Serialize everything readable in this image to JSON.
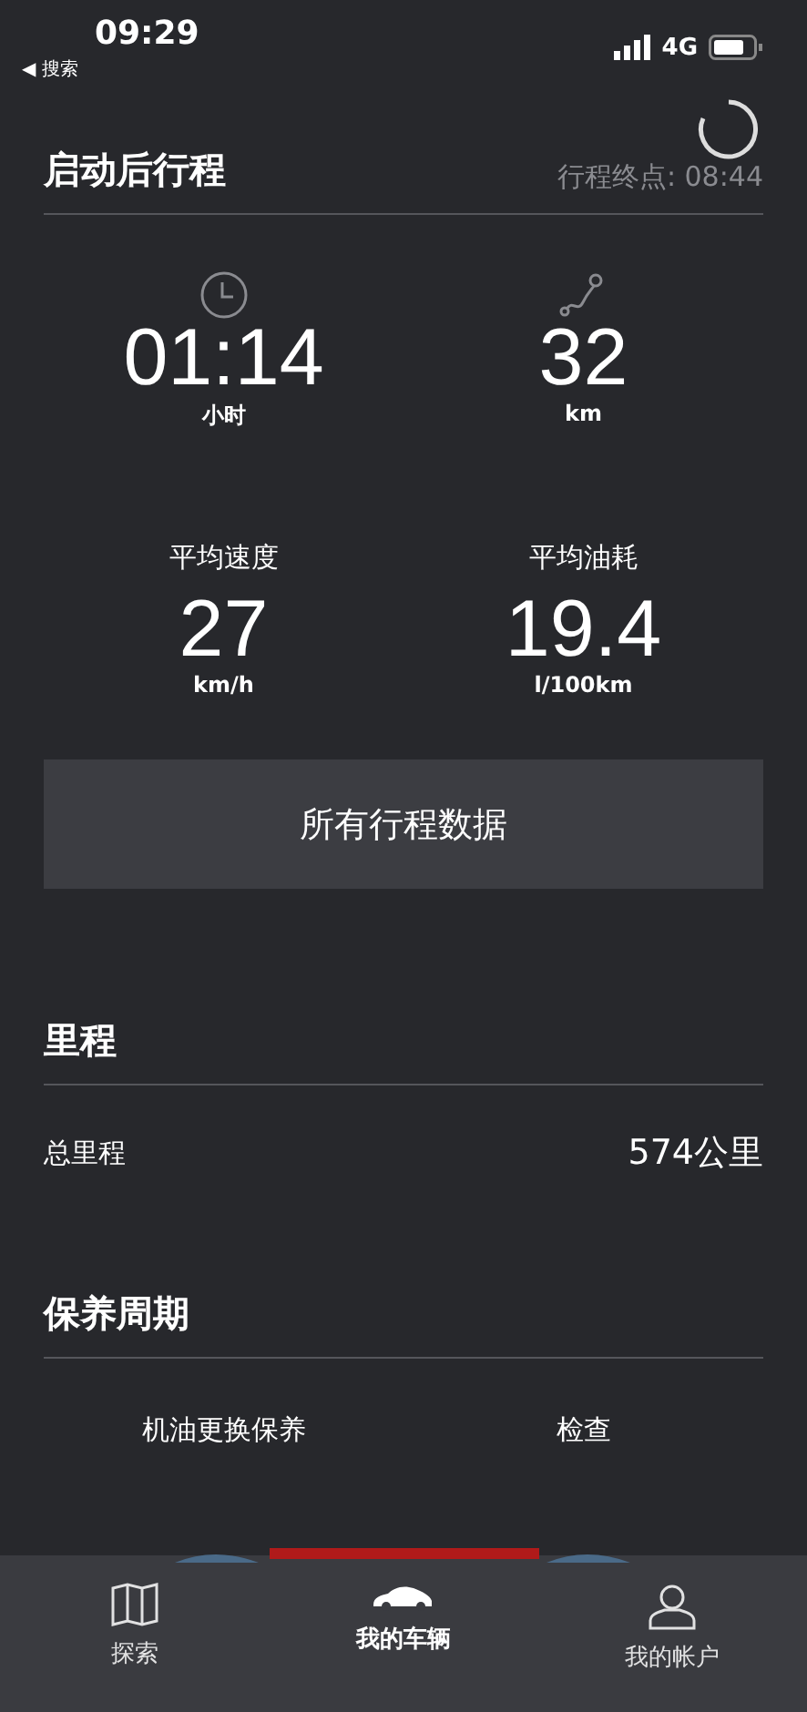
{
  "status_bar": {
    "time": "09:29",
    "back": "◀ 搜索",
    "network": "4G"
  },
  "trip": {
    "title": "启动后行程",
    "end_time": "行程终点: 08:44",
    "stats": [
      {
        "kind": "clock",
        "value": "01:14",
        "unit": "小时"
      },
      {
        "kind": "route",
        "value": "32",
        "unit": "km"
      },
      {
        "kind": "plain",
        "label": "平均速度",
        "value": "27",
        "unit": "km/h"
      },
      {
        "kind": "plain",
        "label": "平均油耗",
        "value": "19.4",
        "unit": "l/100km"
      }
    ],
    "button": "所有行程数据"
  },
  "mileage": {
    "title": "里程",
    "rows": [
      {
        "label": "总里程",
        "value": "574公里"
      }
    ]
  },
  "maintenance": {
    "title": "保养周期",
    "items": [
      {
        "label": "机油更换保养"
      },
      {
        "label": "检查"
      }
    ]
  },
  "tabs": [
    {
      "label": "探索",
      "kind": "map",
      "selected": false
    },
    {
      "label": "我的车辆",
      "kind": "car",
      "selected": true
    },
    {
      "label": "我的帐户",
      "kind": "user",
      "selected": false
    }
  ]
}
